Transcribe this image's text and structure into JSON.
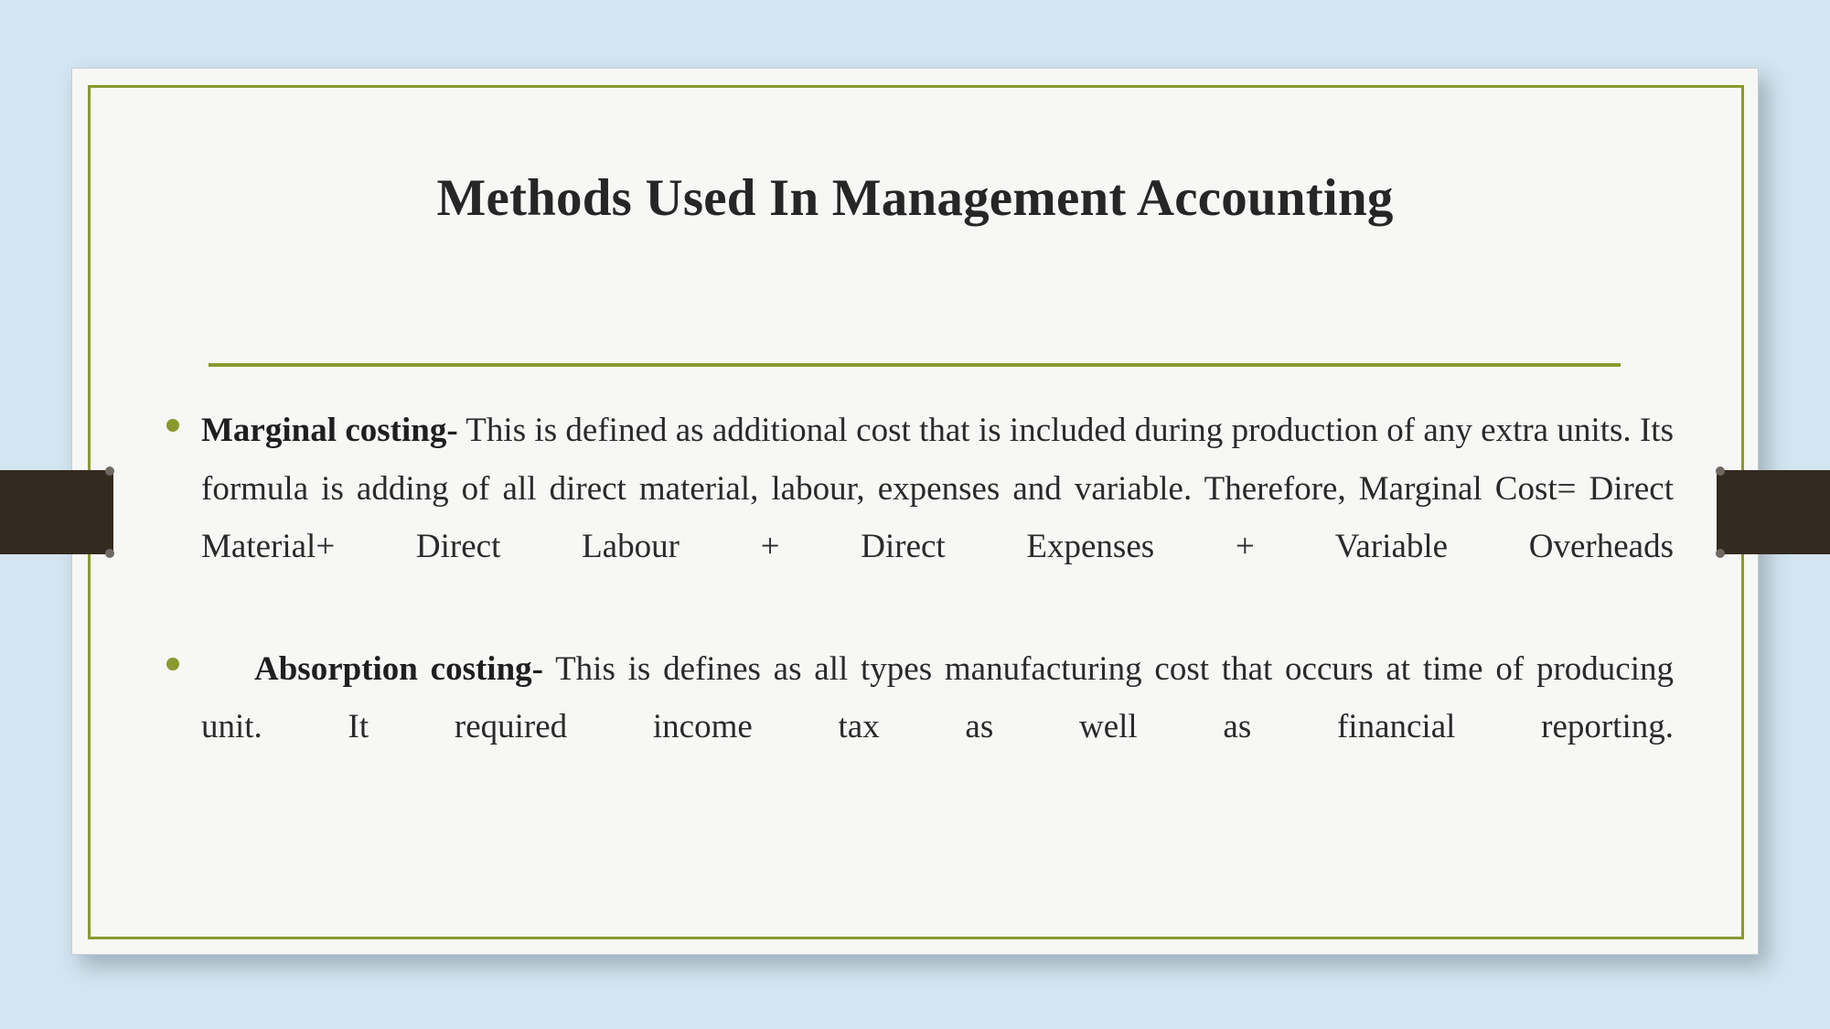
{
  "theme": {
    "background_color": "#d3e5f1",
    "slide_color": "#f7f7f5",
    "frame_color": "#8a992f",
    "accent_color": "#8a992f",
    "ribbon_color": "#332a20",
    "text_color": "#2a2a2a"
  },
  "slide": {
    "title": "Methods Used In Management Accounting",
    "bullets": [
      {
        "marker": "bullet-dot",
        "lead": "Marginal costing-",
        "body": " This is defined as additional cost that is included during production of any extra units. Its formula is adding of all direct material, labour, expenses and variable.  Therefore, Marginal Cost= Direct Material+ Direct Labour + Direct Expenses + Variable Overheads",
        "indented_lead": false
      },
      {
        "marker": "bullet-dot",
        "lead": "Absorption costing-",
        "body": " This is defines as all types manufacturing cost that occurs at time of producing unit. It required income tax as well as financial reporting.",
        "indented_lead": true
      }
    ]
  }
}
